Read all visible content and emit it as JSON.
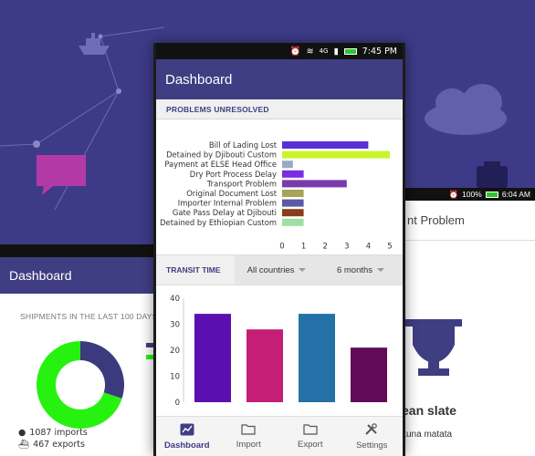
{
  "main_phone": {
    "status": {
      "time": "7:45 PM",
      "network": "4G"
    },
    "app_title": "Dashboard",
    "problems_section": {
      "title": "PROBLEMS UNRESOLVED"
    },
    "transit_filter": {
      "label": "TRANSIT TIME",
      "country": "All countries",
      "period": "6 months"
    },
    "bottom_nav": [
      {
        "label": "Dashboard",
        "icon": "chart-icon",
        "active": true
      },
      {
        "label": "Import",
        "icon": "folder-icon",
        "active": false
      },
      {
        "label": "Export",
        "icon": "folder-icon",
        "active": false
      },
      {
        "label": "Settings",
        "icon": "tools-icon",
        "active": false
      }
    ]
  },
  "left_phone": {
    "app_title": "Dashboard",
    "section_title": "SHIPMENTS IN THE LAST 100 DAYS",
    "imports": "1087 imports",
    "exports": "467 exports"
  },
  "right_phone": {
    "status": {
      "battery": "100%",
      "time": "6:04 AM"
    },
    "title": "nt Problem",
    "empty_title": "ean slate",
    "empty_subtitle": "kuna matata"
  },
  "colors": {
    "primary": "#403e82",
    "hero": "#3d3b87",
    "import_green": "#27f20f",
    "export_navy": "#3b3a7f"
  },
  "chart_data": [
    {
      "type": "bar",
      "orientation": "horizontal",
      "categories": [
        "Bill of Lading Lost",
        "Detained by Djibouti Custom",
        "Payment at ELSE Head Office",
        "Dry Port Process Delay",
        "Transport Problem",
        "Original Document Lost",
        "Importer Internal Problem",
        "Gate Pass Delay at Djibouti",
        "Detained by Ethiopian Custom"
      ],
      "values": [
        4,
        5,
        0.5,
        1,
        3,
        1,
        1,
        1,
        1
      ],
      "colors": [
        "#5930d6",
        "#c9f52a",
        "#9aa9c7",
        "#7a2ee0",
        "#7b3aa9",
        "#a6a35a",
        "#5a5aa6",
        "#8a3d1c",
        "#9fe0a2"
      ],
      "xlim": [
        0,
        5
      ],
      "xticks": [
        0,
        1,
        2,
        3,
        4,
        5
      ]
    },
    {
      "type": "bar",
      "categories": [
        "",
        "",
        "",
        ""
      ],
      "values": [
        34,
        28,
        34,
        21
      ],
      "colors": [
        "#5b0fb0",
        "#c41e76",
        "#2371a6",
        "#620a57"
      ],
      "ylim": [
        0,
        40
      ],
      "yticks": [
        0,
        10,
        20,
        30,
        40
      ]
    },
    {
      "type": "pie",
      "categories": [
        "imports",
        "exports"
      ],
      "values": [
        1087,
        467
      ],
      "colors": [
        "#27f20f",
        "#3b3a7f"
      ]
    }
  ]
}
